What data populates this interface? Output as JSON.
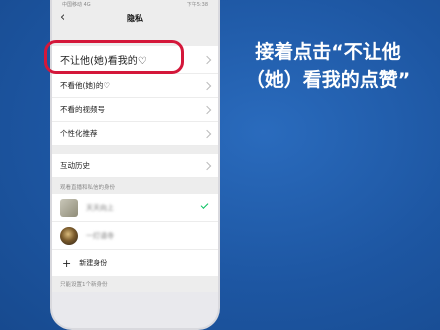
{
  "status_bar": {
    "carrier": "中国移动 4G",
    "time": "下午5:38"
  },
  "nav": {
    "title": "隐私"
  },
  "items": [
    {
      "label": "不让他(她)看我的♡"
    },
    {
      "label": "不看他(她)的♡"
    },
    {
      "label": "不看的视频号"
    },
    {
      "label": "个性化推荐"
    }
  ],
  "history": {
    "label": "互动历史"
  },
  "identity_section": {
    "header": "观看直播和私信的身份",
    "identities": [
      {
        "name": "天天向上"
      },
      {
        "name": "一灯请寺"
      }
    ],
    "new_identity": "新建身份",
    "footer": "只能设置1个新身份"
  },
  "caption": {
    "line1": "接着点击“不让他",
    "line2": "（她）看我的点赞”"
  },
  "colors": {
    "highlight": "#d4173a",
    "background": "#1f5aa7",
    "check": "#07c160"
  }
}
